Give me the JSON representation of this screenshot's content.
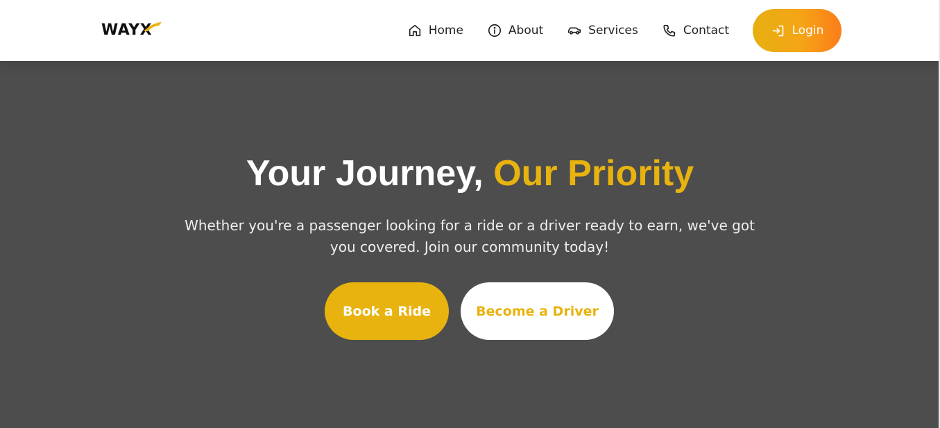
{
  "brand": {
    "name": "WAYX",
    "accent_color": "#e8b30f",
    "logo_icon": "swoosh-icon"
  },
  "nav": {
    "items": [
      {
        "label": "Home",
        "icon": "home-icon"
      },
      {
        "label": "About",
        "icon": "info-icon"
      },
      {
        "label": "Services",
        "icon": "car-icon"
      },
      {
        "label": "Contact",
        "icon": "phone-icon"
      }
    ],
    "login": {
      "label": "Login",
      "icon": "login-icon"
    }
  },
  "hero": {
    "title_main": "Your Journey,",
    "title_accent": "Our Priority",
    "subtitle": "Whether you're a passenger looking for a ride or a driver ready to earn, we've got you covered. Join our community today!",
    "primary_button": "Book a Ride",
    "secondary_button": "Become a Driver"
  },
  "colors": {
    "background": "#4d4d4d",
    "navbar": "#ffffff",
    "accent": "#e8b30f",
    "login_gradient_end": "#fb7d1a"
  }
}
